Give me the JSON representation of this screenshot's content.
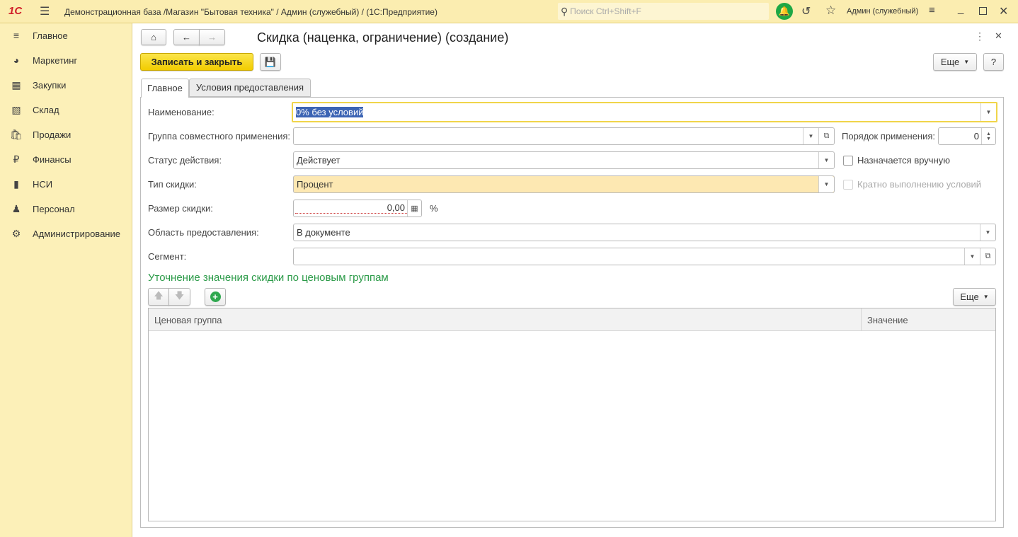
{
  "titlebar": {
    "title": "Демонстрационная база /Магазин \"Бытовая техника\" / Админ (служебный) /  (1С:Предприятие)",
    "search_placeholder": "Поиск Ctrl+Shift+F",
    "user": "Админ (служебный)"
  },
  "sidebar": {
    "items": [
      {
        "label": "Главное",
        "icon": "menu-icon"
      },
      {
        "label": "Маркетинг",
        "icon": "pie-chart-icon"
      },
      {
        "label": "Закупки",
        "icon": "cart-icon"
      },
      {
        "label": "Склад",
        "icon": "warehouse-icon"
      },
      {
        "label": "Продажи",
        "icon": "bag-icon"
      },
      {
        "label": "Финансы",
        "icon": "ruble-icon"
      },
      {
        "label": "НСИ",
        "icon": "book-icon"
      },
      {
        "label": "Персонал",
        "icon": "person-icon"
      },
      {
        "label": "Администрирование",
        "icon": "gear-icon"
      }
    ]
  },
  "form": {
    "title": "Скидка (наценка, ограничение) (создание)",
    "save_close": "Записать и закрыть",
    "more": "Еще",
    "help": "?",
    "tabs": [
      "Главное",
      "Условия предоставления"
    ],
    "fields": {
      "name": {
        "label": "Наименование:",
        "value": "0% без условий"
      },
      "group": {
        "label": "Группа совместного применения:",
        "value": ""
      },
      "order": {
        "label": "Порядок применения:",
        "value": "0"
      },
      "status": {
        "label": "Статус действия:",
        "value": "Действует"
      },
      "manual": {
        "label": "Назначается вручную",
        "checked": false
      },
      "type": {
        "label": "Тип скидки:",
        "value": "Процент"
      },
      "multiple": {
        "label": "Кратно выполнению условий",
        "checked": false,
        "disabled": true
      },
      "size": {
        "label": "Размер скидки:",
        "value": "0,00",
        "unit": "%"
      },
      "area": {
        "label": "Область предоставления:",
        "value": "В документе"
      },
      "segment": {
        "label": "Сегмент:",
        "value": ""
      }
    },
    "section_title": "Уточнение значения скидки по ценовым группам",
    "table": {
      "more": "Еще",
      "columns": [
        "Ценовая группа",
        "Значение"
      ],
      "rows": []
    }
  },
  "colors": {
    "accent": "#f5d923",
    "section": "#2a9a47",
    "topbar": "#fbedb0"
  }
}
